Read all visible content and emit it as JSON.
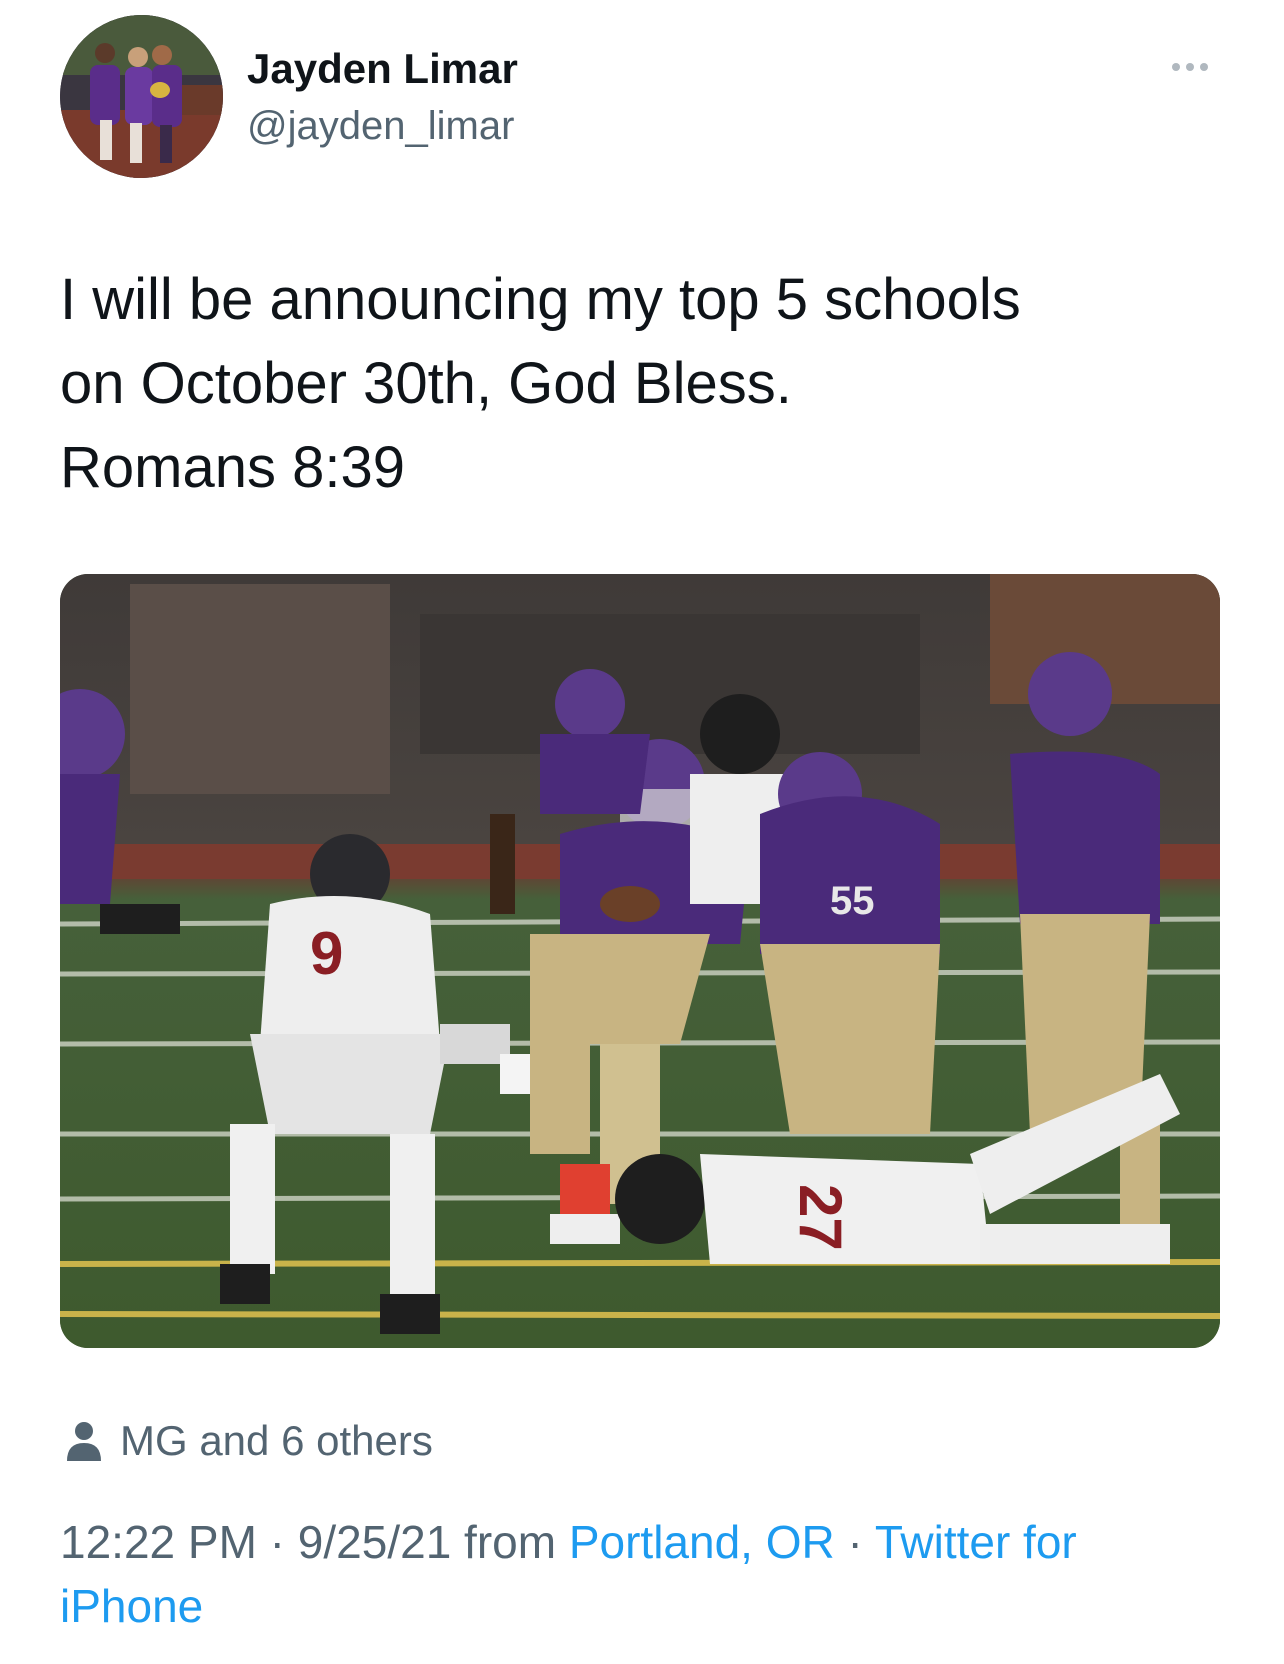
{
  "author": {
    "name": "Jayden Limar",
    "handle": "@jayden_limar",
    "avatar_description": "group-photo"
  },
  "more_icon": "more-horizontal-icon",
  "tweet": {
    "lines": [
      "I will be announcing my top 5 schools",
      "on October 30th, God Bless.",
      "Romans 8:39"
    ]
  },
  "media": {
    "type": "photo",
    "subject": "football-game"
  },
  "likers": {
    "icon": "person-icon",
    "text": "MG and 6 others"
  },
  "meta": {
    "time": "12:22 PM",
    "sep1": " · ",
    "date": "9/25/21",
    "from": " from ",
    "location": "Portland, OR",
    "sep2": " · ",
    "client_line1": "Twitter for",
    "client_line2": "iPhone"
  },
  "colors": {
    "text": "#0f1419",
    "secondary": "#536471",
    "link": "#1d9bf0"
  }
}
